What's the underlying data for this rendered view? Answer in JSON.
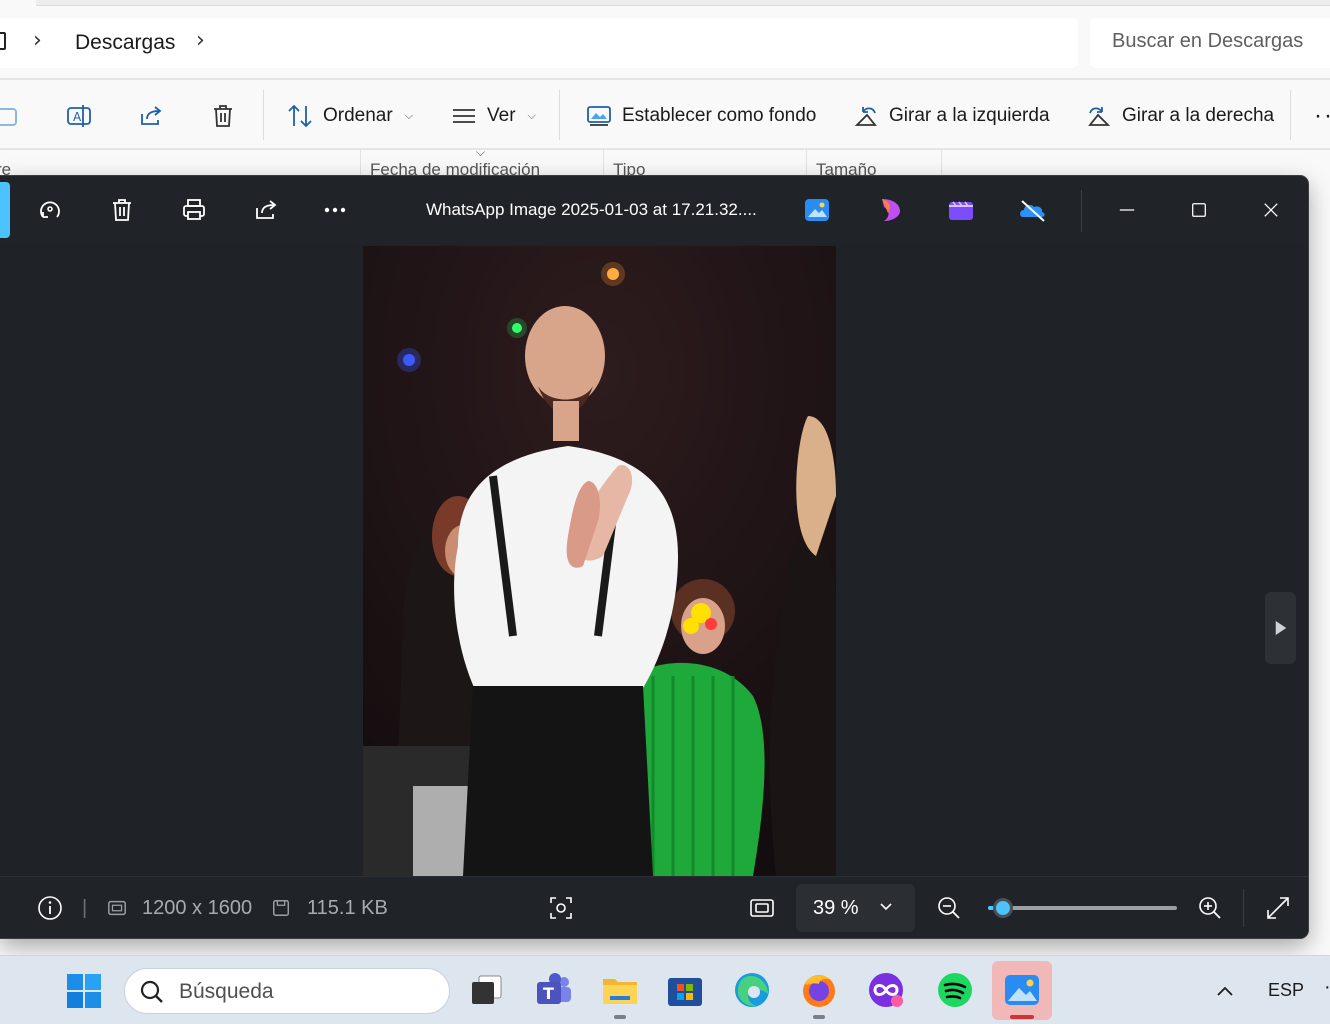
{
  "explorer": {
    "breadcrumb": [
      "Descargas"
    ],
    "search_placeholder": "Buscar en Descargas",
    "commands": {
      "sort": "Ordenar",
      "view": "Ver",
      "set_background": "Establecer como fondo",
      "rotate_left": "Girar a la izquierda",
      "rotate_right": "Girar a la derecha"
    },
    "columns": {
      "name_partial": "re",
      "modified": "Fecha de modificación",
      "type": "Tipo",
      "size": "Tamaño"
    }
  },
  "viewer": {
    "title": "WhatsApp Image 2025-01-03 at 17.21.32....",
    "status": {
      "dimensions": "1200 x 1600",
      "file_size": "115.1 KB",
      "zoom": "39 %",
      "zoom_slider_fraction": 0.08
    },
    "photo_alt": "Hombre con tirantes aplaudiendo en un escenario",
    "accent_color": "#4cc2ff"
  },
  "taskbar": {
    "search_placeholder": "Búsqueda",
    "language": "ESP",
    "apps": [
      "task-view",
      "teams",
      "file-explorer",
      "microsoft-store",
      "edge",
      "firefox",
      "clipchamp",
      "spotify",
      "photos"
    ],
    "active_app": "photos"
  }
}
